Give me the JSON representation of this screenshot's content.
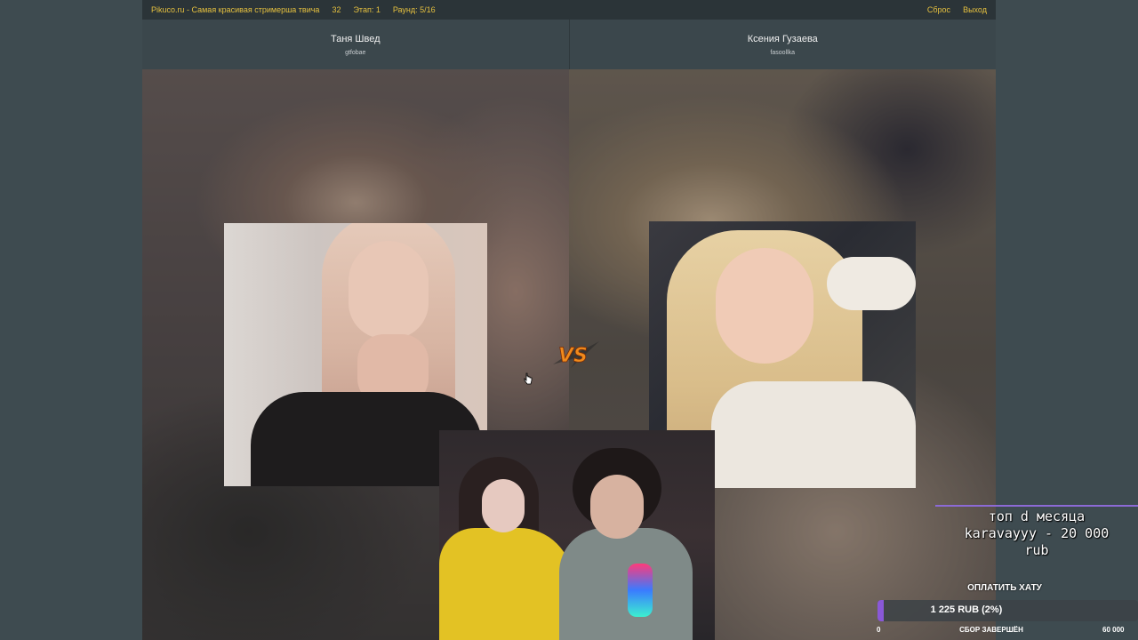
{
  "topbar": {
    "site_title": "Pikuco.ru - Самая красивая стримерша твича",
    "count": "32",
    "stage": "Этап: 1",
    "round": "Раунд: 5/16",
    "reset": "Сброс",
    "exit": "Выход"
  },
  "left": {
    "name": "Таня Швед",
    "nickname": "gtfobae"
  },
  "right": {
    "name": "Ксения Гузаева",
    "nickname": "fasoollka"
  },
  "vs_icon": "vs-icon",
  "colors": {
    "accent_yellow": "#e5c03f",
    "progress_purple": "#8a58d8",
    "background": "#3e4b50"
  },
  "overlay": {
    "donation_line1": "топ d месяца",
    "donation_line2": "karavayyy - 20 000",
    "donation_line3": "rub",
    "pay_title": "ОПЛАТИТЬ ХАТУ",
    "progress_label": "1 225 RUB (2%)",
    "progress_percent": 2,
    "min": "0",
    "status": "СБОР ЗАВЕРШЁН",
    "max": "60 000"
  }
}
